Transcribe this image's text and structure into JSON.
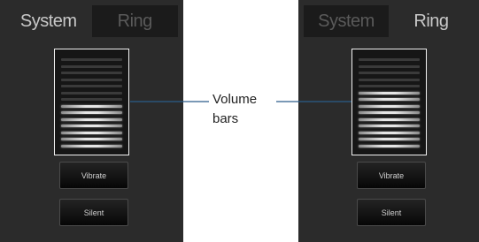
{
  "screens": [
    {
      "tabs": [
        {
          "label": "System",
          "active": true
        },
        {
          "label": "Ring",
          "active": false
        }
      ],
      "volume": {
        "total_bars": 14,
        "filled_bars": 7
      },
      "buttons": {
        "vibrate": "Vibrate",
        "silent": "Silent"
      }
    },
    {
      "tabs": [
        {
          "label": "System",
          "active": false
        },
        {
          "label": "Ring",
          "active": true
        }
      ],
      "volume": {
        "total_bars": 14,
        "filled_bars": 9
      },
      "buttons": {
        "vibrate": "Vibrate",
        "silent": "Silent"
      }
    }
  ],
  "callout": {
    "line1": "Volume",
    "line2": "bars"
  },
  "colors": {
    "screen_bg": "#2b2b2b",
    "bar_filled": "#e6e6e6",
    "bar_empty": "#3a3a3a",
    "frame": "#f2f2f2",
    "callout_line": "#2a5c8a"
  }
}
